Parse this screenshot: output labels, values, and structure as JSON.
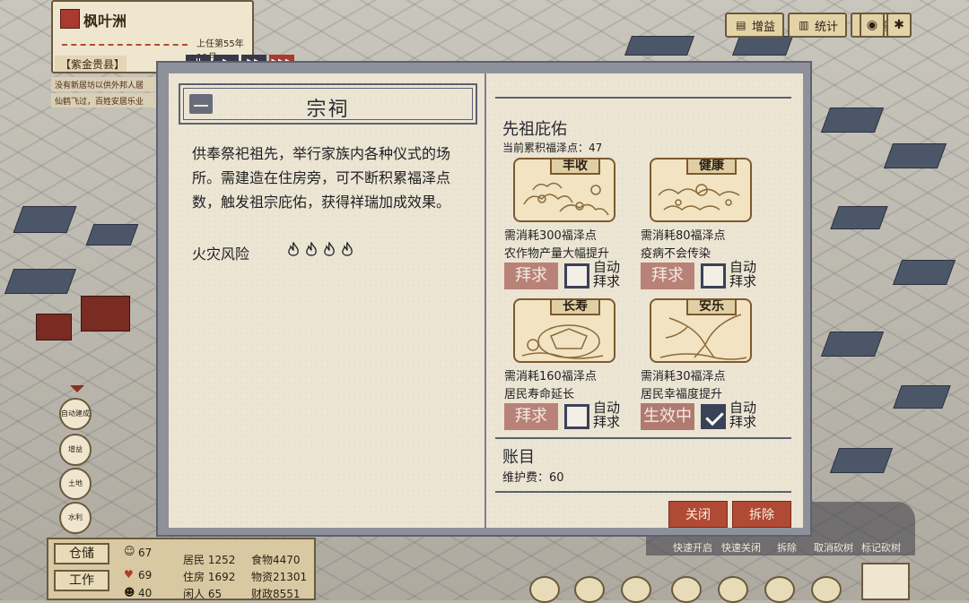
{
  "city": {
    "name": "枫叶洲",
    "date": "上任第55年 11月",
    "county": "【紫金贵县】",
    "speed_buttons": [
      "II",
      "▶",
      "▶▶",
      "▶▶▶"
    ]
  },
  "notices": [
    "没有新居坊以供外邦人居",
    "仙鹤飞过，百姓安居乐业"
  ],
  "toolbar": {
    "buttons": [
      {
        "icon": "gain-icon",
        "label": "增益"
      },
      {
        "icon": "stats-icon",
        "label": "统计"
      },
      {
        "icon": "help-icon",
        "label": "帮助"
      }
    ]
  },
  "side_buttons": [
    "自动建成",
    "增益",
    "土地",
    "水利"
  ],
  "stats": {
    "storage_label": "仓储",
    "work_label": "工作",
    "happy": "67",
    "health": "69",
    "labor": "40",
    "residents": "居民 1252",
    "housing": "住房 1692",
    "idle": "闲人 65",
    "food": "食物4470",
    "goods": "物资21301",
    "finance": "财政8551"
  },
  "quick_actions": [
    "快速开启",
    "快速关闭",
    "拆除",
    "取消砍树",
    "标记砍树"
  ],
  "building": {
    "title": "宗祠",
    "description": "供奉祭祀祖先，举行家族内各种仪式的场所。需建造在住房旁，可不断积累福泽点数，触发祖宗庇佑，获得祥瑞加成效果。",
    "fire_risk_label": "火灾风险",
    "fire_risk_level": 4
  },
  "blessing": {
    "section_title": "先祖庇佑",
    "points_text": "当前累积福泽点：47",
    "auto_label": "自动拜求",
    "items": [
      {
        "name": "丰收",
        "cost": "需消耗300福泽点",
        "effect": "农作物产量大幅提升",
        "button": "拜求",
        "auto": false,
        "active": false
      },
      {
        "name": "健康",
        "cost": "需消耗80福泽点",
        "effect": "疫病不会传染",
        "button": "拜求",
        "auto": false,
        "active": false
      },
      {
        "name": "长寿",
        "cost": "需消耗160福泽点",
        "effect": "居民寿命延长",
        "button": "拜求",
        "auto": false,
        "active": false
      },
      {
        "name": "安乐",
        "cost": "需消耗30福泽点",
        "effect": "居民幸福度提升",
        "button": "生效中",
        "auto": true,
        "active": true
      }
    ]
  },
  "ledger": {
    "title": "账目",
    "upkeep": "维护费：60"
  },
  "actions": {
    "close": "关闭",
    "demolish": "拆除"
  }
}
